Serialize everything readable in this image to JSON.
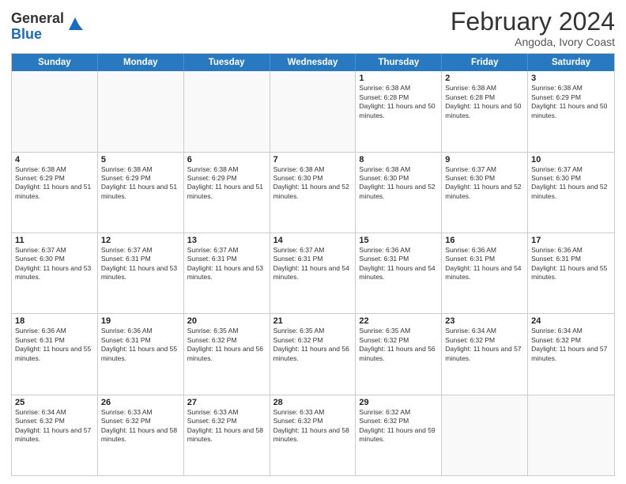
{
  "header": {
    "logo_general": "General",
    "logo_blue": "Blue",
    "month_year": "February 2024",
    "location": "Angoda, Ivory Coast"
  },
  "days_of_week": [
    "Sunday",
    "Monday",
    "Tuesday",
    "Wednesday",
    "Thursday",
    "Friday",
    "Saturday"
  ],
  "rows": [
    [
      {
        "day": "",
        "info": ""
      },
      {
        "day": "",
        "info": ""
      },
      {
        "day": "",
        "info": ""
      },
      {
        "day": "",
        "info": ""
      },
      {
        "day": "1",
        "info": "Sunrise: 6:38 AM\nSunset: 6:28 PM\nDaylight: 11 hours and 50 minutes."
      },
      {
        "day": "2",
        "info": "Sunrise: 6:38 AM\nSunset: 6:28 PM\nDaylight: 11 hours and 50 minutes."
      },
      {
        "day": "3",
        "info": "Sunrise: 6:38 AM\nSunset: 6:29 PM\nDaylight: 11 hours and 50 minutes."
      }
    ],
    [
      {
        "day": "4",
        "info": "Sunrise: 6:38 AM\nSunset: 6:29 PM\nDaylight: 11 hours and 51 minutes."
      },
      {
        "day": "5",
        "info": "Sunrise: 6:38 AM\nSunset: 6:29 PM\nDaylight: 11 hours and 51 minutes."
      },
      {
        "day": "6",
        "info": "Sunrise: 6:38 AM\nSunset: 6:29 PM\nDaylight: 11 hours and 51 minutes."
      },
      {
        "day": "7",
        "info": "Sunrise: 6:38 AM\nSunset: 6:30 PM\nDaylight: 11 hours and 52 minutes."
      },
      {
        "day": "8",
        "info": "Sunrise: 6:38 AM\nSunset: 6:30 PM\nDaylight: 11 hours and 52 minutes."
      },
      {
        "day": "9",
        "info": "Sunrise: 6:37 AM\nSunset: 6:30 PM\nDaylight: 11 hours and 52 minutes."
      },
      {
        "day": "10",
        "info": "Sunrise: 6:37 AM\nSunset: 6:30 PM\nDaylight: 11 hours and 52 minutes."
      }
    ],
    [
      {
        "day": "11",
        "info": "Sunrise: 6:37 AM\nSunset: 6:30 PM\nDaylight: 11 hours and 53 minutes."
      },
      {
        "day": "12",
        "info": "Sunrise: 6:37 AM\nSunset: 6:31 PM\nDaylight: 11 hours and 53 minutes."
      },
      {
        "day": "13",
        "info": "Sunrise: 6:37 AM\nSunset: 6:31 PM\nDaylight: 11 hours and 53 minutes."
      },
      {
        "day": "14",
        "info": "Sunrise: 6:37 AM\nSunset: 6:31 PM\nDaylight: 11 hours and 54 minutes."
      },
      {
        "day": "15",
        "info": "Sunrise: 6:36 AM\nSunset: 6:31 PM\nDaylight: 11 hours and 54 minutes."
      },
      {
        "day": "16",
        "info": "Sunrise: 6:36 AM\nSunset: 6:31 PM\nDaylight: 11 hours and 54 minutes."
      },
      {
        "day": "17",
        "info": "Sunrise: 6:36 AM\nSunset: 6:31 PM\nDaylight: 11 hours and 55 minutes."
      }
    ],
    [
      {
        "day": "18",
        "info": "Sunrise: 6:36 AM\nSunset: 6:31 PM\nDaylight: 11 hours and 55 minutes."
      },
      {
        "day": "19",
        "info": "Sunrise: 6:36 AM\nSunset: 6:31 PM\nDaylight: 11 hours and 55 minutes."
      },
      {
        "day": "20",
        "info": "Sunrise: 6:35 AM\nSunset: 6:32 PM\nDaylight: 11 hours and 56 minutes."
      },
      {
        "day": "21",
        "info": "Sunrise: 6:35 AM\nSunset: 6:32 PM\nDaylight: 11 hours and 56 minutes."
      },
      {
        "day": "22",
        "info": "Sunrise: 6:35 AM\nSunset: 6:32 PM\nDaylight: 11 hours and 56 minutes."
      },
      {
        "day": "23",
        "info": "Sunrise: 6:34 AM\nSunset: 6:32 PM\nDaylight: 11 hours and 57 minutes."
      },
      {
        "day": "24",
        "info": "Sunrise: 6:34 AM\nSunset: 6:32 PM\nDaylight: 11 hours and 57 minutes."
      }
    ],
    [
      {
        "day": "25",
        "info": "Sunrise: 6:34 AM\nSunset: 6:32 PM\nDaylight: 11 hours and 57 minutes."
      },
      {
        "day": "26",
        "info": "Sunrise: 6:33 AM\nSunset: 6:32 PM\nDaylight: 11 hours and 58 minutes."
      },
      {
        "day": "27",
        "info": "Sunrise: 6:33 AM\nSunset: 6:32 PM\nDaylight: 11 hours and 58 minutes."
      },
      {
        "day": "28",
        "info": "Sunrise: 6:33 AM\nSunset: 6:32 PM\nDaylight: 11 hours and 58 minutes."
      },
      {
        "day": "29",
        "info": "Sunrise: 6:32 AM\nSunset: 6:32 PM\nDaylight: 11 hours and 59 minutes."
      },
      {
        "day": "",
        "info": ""
      },
      {
        "day": "",
        "info": ""
      }
    ]
  ]
}
